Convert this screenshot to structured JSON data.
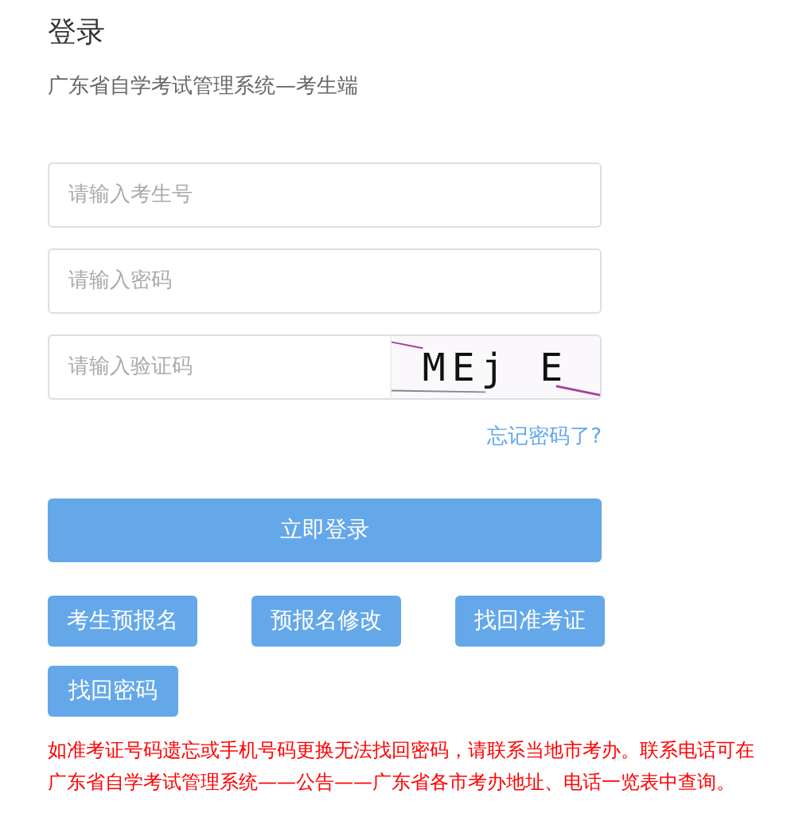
{
  "title": "登录",
  "subtitle": "广东省自学考试管理系统—考生端",
  "fields": [
    {
      "placeholder": "请输入考生号",
      "kind": "text"
    },
    {
      "placeholder": "请输入密码",
      "kind": "password"
    },
    {
      "placeholder": "请输入验证码",
      "kind": "captcha",
      "captcha": "MEj E"
    }
  ],
  "forgot_link": "忘记密码了?",
  "login_button": "立即登录",
  "buttons": [
    "考生预报名",
    "预报名修改",
    "找回准考证",
    "找回密码"
  ],
  "notice": "如准考证号码遗忘或手机号码更换无法找回密码，请联系当地市考办。联系电话可在广东省自学考试管理系统——公告——广东省各市考办地址、电话一览表中查询。"
}
